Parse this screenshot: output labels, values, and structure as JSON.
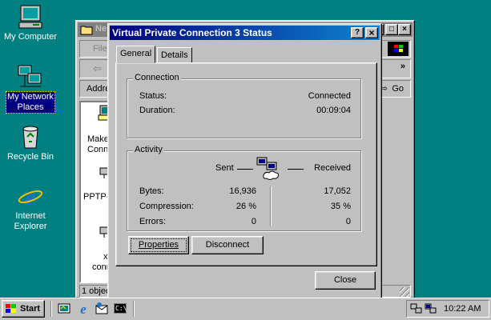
{
  "desktop": {
    "icons": [
      {
        "label": "My Computer"
      },
      {
        "label_line1": "My Network",
        "label_line2": "Places"
      },
      {
        "label": "Recycle Bin"
      },
      {
        "label_line1": "Internet",
        "label_line2": "Explorer"
      }
    ]
  },
  "background_window": {
    "title_partial": "Ne",
    "menu_partial": "File",
    "address_partial": "Addre",
    "go_label": "Go",
    "chevron": "»",
    "items": [
      {
        "line1": "Make",
        "line2": "Conn"
      },
      {
        "line1": "PPTP-"
      },
      {
        "line1": "x",
        "line2": "conn"
      }
    ],
    "status_partial": "1 objec"
  },
  "dialog": {
    "title": "Virtual Private Connection 3 Status",
    "help_btn": "?",
    "close_btn": "×",
    "tabs": [
      "General",
      "Details"
    ],
    "connection": {
      "group_label": "Connection",
      "status_label": "Status:",
      "status_value": "Connected",
      "duration_label": "Duration:",
      "duration_value": "00:09:04"
    },
    "activity": {
      "group_label": "Activity",
      "sent_label": "Sent",
      "received_label": "Received",
      "rows": [
        {
          "label": "Bytes:",
          "sent": "16,936",
          "received": "17,052"
        },
        {
          "label": "Compression:",
          "sent": "26 %",
          "received": "35 %"
        },
        {
          "label": "Errors:",
          "sent": "0",
          "received": "0"
        }
      ]
    },
    "properties_btn": "Properties",
    "disconnect_btn": "Disconnect",
    "close_btn_label": "Close"
  },
  "taskbar": {
    "start_label": "Start",
    "clock": "10:22 AM"
  }
}
